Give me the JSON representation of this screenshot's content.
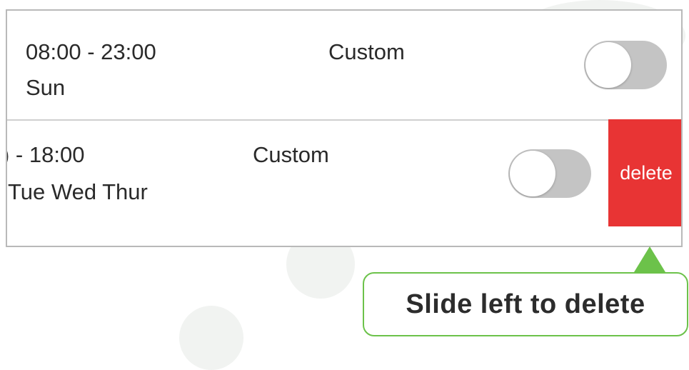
{
  "rows": [
    {
      "time": "08:00 - 23:00",
      "days": "Sun",
      "mode": "Custom",
      "enabled": false
    },
    {
      "time": ") - 18:00",
      "days": "Tue Wed Thur",
      "mode": "Custom",
      "enabled": false,
      "delete_label": "delete"
    }
  ],
  "callout": {
    "text": "Slide left to delete"
  },
  "colors": {
    "delete": "#e83434",
    "callout_border": "#6cc24a",
    "toggle_off": "#c4c4c4"
  }
}
